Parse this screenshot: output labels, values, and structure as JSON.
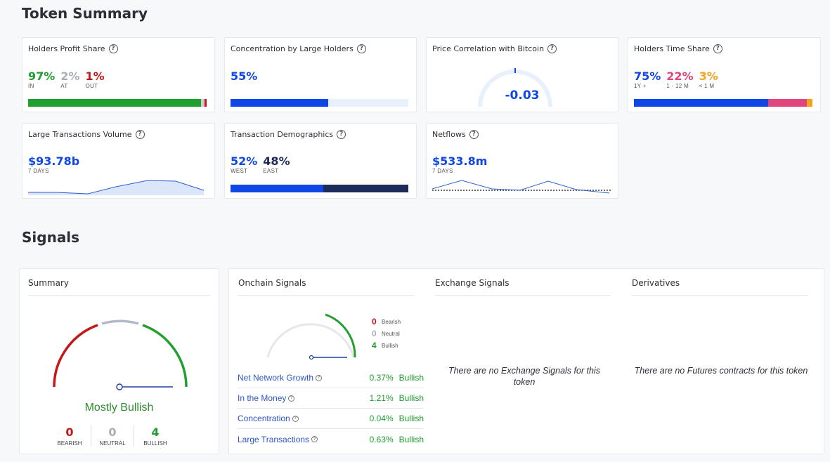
{
  "token_summary": {
    "title": "Token Summary",
    "holders_profit": {
      "title": "Holders Profit Share",
      "in": {
        "value": "97%",
        "label": "IN",
        "pct": 97
      },
      "at": {
        "value": "2%",
        "label": "AT",
        "pct": 2
      },
      "out": {
        "value": "1%",
        "label": "OUT",
        "pct": 1
      },
      "colors": {
        "in": "#22a02f",
        "at": "#c9ccd3",
        "out": "#c41818"
      }
    },
    "concentration": {
      "title": "Concentration by Large Holders",
      "value": "55%",
      "pct": 55
    },
    "price_correlation": {
      "title": "Price Correlation with Bitcoin",
      "value": "-0.03"
    },
    "holders_time": {
      "title": "Holders Time Share",
      "long": {
        "value": "75%",
        "label": "1Y +",
        "pct": 75
      },
      "mid": {
        "value": "22%",
        "label": "1 - 12 M",
        "pct": 22
      },
      "short": {
        "value": "3%",
        "label": "< 1 M",
        "pct": 3
      }
    },
    "large_tx": {
      "title": "Large Transactions Volume",
      "value": "$93.78b",
      "period": "7 DAYS"
    },
    "demographics": {
      "title": "Transaction Demographics",
      "west": {
        "value": "52%",
        "label": "WEST",
        "pct": 52
      },
      "east": {
        "value": "48%",
        "label": "EAST",
        "pct": 48
      }
    },
    "netflows": {
      "title": "Netflows",
      "value": "$533.8m",
      "period": "7 DAYS"
    }
  },
  "signals": {
    "title": "Signals",
    "summary": {
      "title": "Summary",
      "verdict": "Mostly Bullish",
      "bearish": {
        "count": "0",
        "label": "BEARISH"
      },
      "neutral": {
        "count": "0",
        "label": "NEUTRAL"
      },
      "bullish": {
        "count": "4",
        "label": "BULLISH"
      }
    },
    "onchain": {
      "title": "Onchain Signals",
      "legend": {
        "bearish": {
          "count": "0",
          "label": "Bearish"
        },
        "neutral": {
          "count": "0",
          "label": "Neutral"
        },
        "bullish": {
          "count": "4",
          "label": "Bullish"
        }
      },
      "rows": [
        {
          "name": "Net Network Growth",
          "value": "0.37%",
          "signal": "Bullish"
        },
        {
          "name": "In the Money",
          "value": "1.21%",
          "signal": "Bullish"
        },
        {
          "name": "Concentration",
          "value": "0.04%",
          "signal": "Bullish"
        },
        {
          "name": "Large Transactions",
          "value": "0.63%",
          "signal": "Bullish"
        }
      ]
    },
    "exchange": {
      "title": "Exchange Signals",
      "empty": "There are no Exchange Signals for this token"
    },
    "derivatives": {
      "title": "Derivatives",
      "empty": "There are no Futures contracts for this token"
    }
  },
  "icons": {
    "help": "question-circle-icon"
  }
}
